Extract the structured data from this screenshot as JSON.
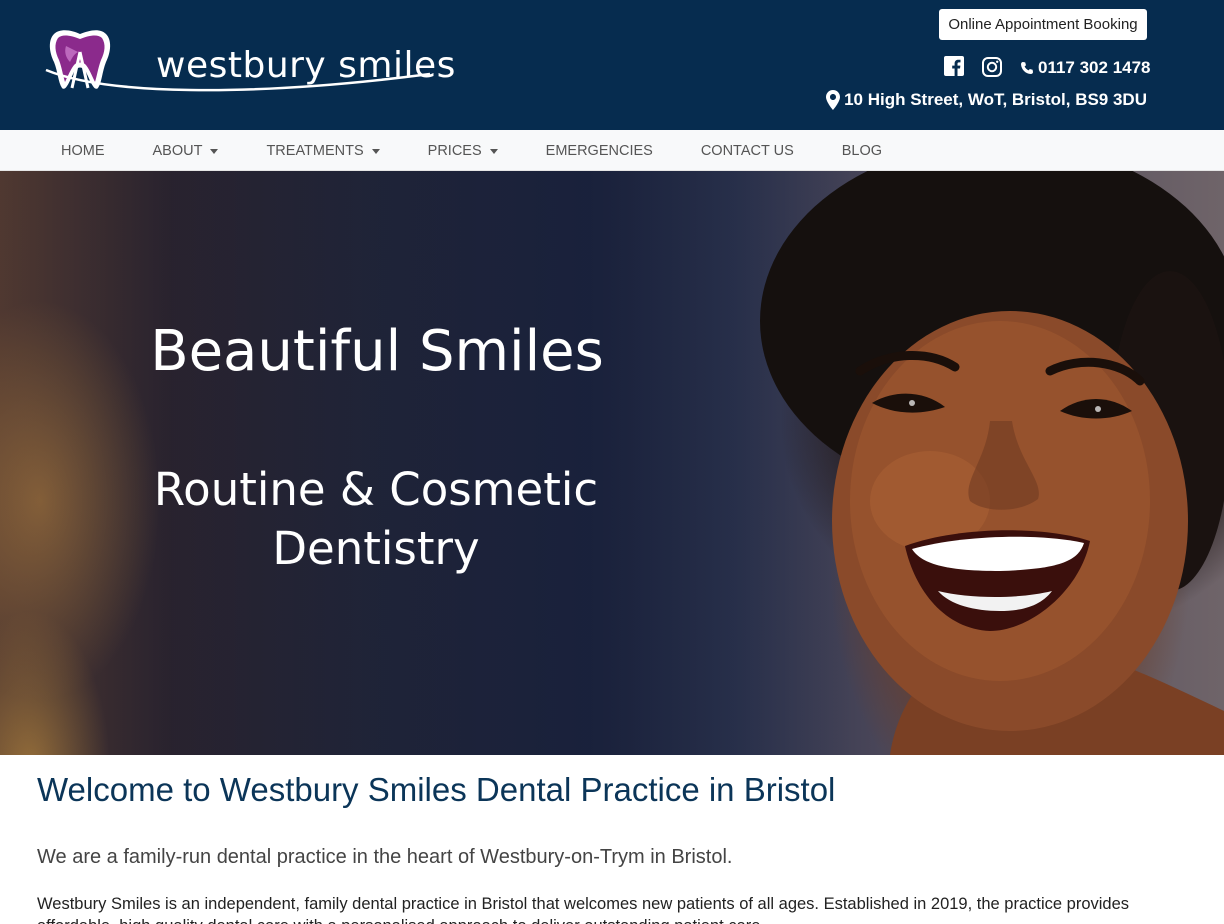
{
  "header": {
    "logo_text": "westbury smiles",
    "booking_button": "Online Appointment Booking",
    "phone": "0117 302 1478",
    "address": "10 High Street, WoT, Bristol, BS9 3DU",
    "social": [
      "facebook-icon",
      "instagram-icon"
    ]
  },
  "nav": {
    "items": [
      {
        "label": "HOME",
        "dropdown": false
      },
      {
        "label": "ABOUT",
        "dropdown": true
      },
      {
        "label": "TREATMENTS",
        "dropdown": true
      },
      {
        "label": "PRICES",
        "dropdown": true
      },
      {
        "label": "EMERGENCIES",
        "dropdown": false
      },
      {
        "label": "CONTACT US",
        "dropdown": false
      },
      {
        "label": "BLOG",
        "dropdown": false
      }
    ]
  },
  "hero": {
    "title": "Beautiful Smiles",
    "subtitle": "Routine & Cosmetic Dentistry"
  },
  "main": {
    "heading": "Welcome to Westbury Smiles Dental Practice in Bristol",
    "lead": "We are a family-run dental practice in the heart of Westbury-on-Trym in Bristol.",
    "paragraph": "Westbury Smiles is an independent, family dental practice in Bristol that welcomes new patients of all ages. Established in 2019, the practice provides affordable, high quality dental care with a personalised approach to deliver outstanding patient care."
  },
  "colors": {
    "header_bg": "#062c4f",
    "nav_bg": "#f8f9fa",
    "heading": "#0b3558",
    "logo_accent": "#8b2a8c"
  }
}
